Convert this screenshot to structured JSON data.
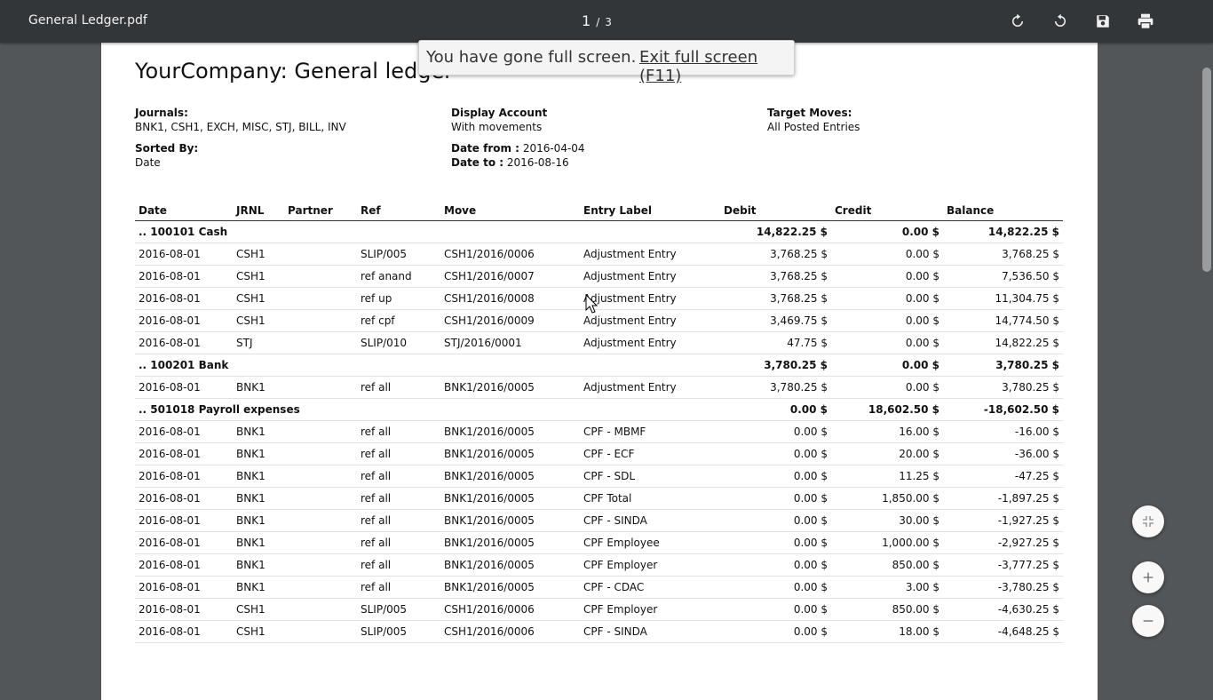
{
  "toolbar": {
    "doc_title": "General Ledger.pdf",
    "page_current": "1",
    "page_separator": "/",
    "page_total": "3",
    "icons": [
      "rotate-clockwise-icon",
      "rotate-counterclockwise-icon",
      "save-icon",
      "print-icon"
    ]
  },
  "fullscreen_toast": {
    "message": "You have gone full screen.",
    "exit_label": "Exit full screen (F11)"
  },
  "report": {
    "title": "YourCompany: General ledger",
    "journals_label": "Journals:",
    "journals_value": "BNK1, CSH1, EXCH, MISC, STJ, BILL, INV",
    "display_account_label": "Display Account",
    "display_account_value": "With movements",
    "target_moves_label": "Target Moves:",
    "target_moves_value": "All Posted Entries",
    "sorted_by_label": "Sorted By:",
    "sorted_by_value": "Date",
    "date_from_label": "Date from :",
    "date_from_value": "2016-04-04",
    "date_to_label": "Date to :",
    "date_to_value": "2016-08-16",
    "columns": [
      "Date",
      "JRNL",
      "Partner",
      "Ref",
      "Move",
      "Entry Label",
      "Debit",
      "Credit",
      "Balance"
    ],
    "rows": [
      {
        "type": "account",
        "label": ".. 100101 Cash",
        "debit": "14,822.25 $",
        "credit": "0.00 $",
        "balance": "14,822.25 $"
      },
      {
        "type": "line",
        "date": "2016-08-01",
        "jrnl": "CSH1",
        "partner": "",
        "ref": "SLIP/005",
        "move": "CSH1/2016/0006",
        "entry": "Adjustment Entry",
        "debit": "3,768.25 $",
        "credit": "0.00 $",
        "balance": "3,768.25 $"
      },
      {
        "type": "line",
        "date": "2016-08-01",
        "jrnl": "CSH1",
        "partner": "",
        "ref": "ref anand",
        "move": "CSH1/2016/0007",
        "entry": "Adjustment Entry",
        "debit": "3,768.25 $",
        "credit": "0.00 $",
        "balance": "7,536.50 $"
      },
      {
        "type": "line",
        "date": "2016-08-01",
        "jrnl": "CSH1",
        "partner": "",
        "ref": "ref up",
        "move": "CSH1/2016/0008",
        "entry": "Adjustment Entry",
        "debit": "3,768.25 $",
        "credit": "0.00 $",
        "balance": "11,304.75 $"
      },
      {
        "type": "line",
        "date": "2016-08-01",
        "jrnl": "CSH1",
        "partner": "",
        "ref": "ref cpf",
        "move": "CSH1/2016/0009",
        "entry": "Adjustment Entry",
        "debit": "3,469.75 $",
        "credit": "0.00 $",
        "balance": "14,774.50 $"
      },
      {
        "type": "line",
        "date": "2016-08-01",
        "jrnl": "STJ",
        "partner": "",
        "ref": "SLIP/010",
        "move": "STJ/2016/0001",
        "entry": "Adjustment Entry",
        "debit": "47.75 $",
        "credit": "0.00 $",
        "balance": "14,822.25 $"
      },
      {
        "type": "account",
        "label": ".. 100201 Bank",
        "debit": "3,780.25 $",
        "credit": "0.00 $",
        "balance": "3,780.25 $"
      },
      {
        "type": "line",
        "date": "2016-08-01",
        "jrnl": "BNK1",
        "partner": "",
        "ref": "ref all",
        "move": "BNK1/2016/0005",
        "entry": "Adjustment Entry",
        "debit": "3,780.25 $",
        "credit": "0.00 $",
        "balance": "3,780.25 $"
      },
      {
        "type": "account",
        "label": ".. 501018 Payroll expenses",
        "debit": "0.00 $",
        "credit": "18,602.50 $",
        "balance": "-18,602.50 $"
      },
      {
        "type": "line",
        "date": "2016-08-01",
        "jrnl": "BNK1",
        "partner": "",
        "ref": "ref all",
        "move": "BNK1/2016/0005",
        "entry": "CPF - MBMF",
        "debit": "0.00 $",
        "credit": "16.00 $",
        "balance": "-16.00 $"
      },
      {
        "type": "line",
        "date": "2016-08-01",
        "jrnl": "BNK1",
        "partner": "",
        "ref": "ref all",
        "move": "BNK1/2016/0005",
        "entry": "CPF - ECF",
        "debit": "0.00 $",
        "credit": "20.00 $",
        "balance": "-36.00 $"
      },
      {
        "type": "line",
        "date": "2016-08-01",
        "jrnl": "BNK1",
        "partner": "",
        "ref": "ref all",
        "move": "BNK1/2016/0005",
        "entry": "CPF - SDL",
        "debit": "0.00 $",
        "credit": "11.25 $",
        "balance": "-47.25 $"
      },
      {
        "type": "line",
        "date": "2016-08-01",
        "jrnl": "BNK1",
        "partner": "",
        "ref": "ref all",
        "move": "BNK1/2016/0005",
        "entry": "CPF Total",
        "debit": "0.00 $",
        "credit": "1,850.00 $",
        "balance": "-1,897.25 $"
      },
      {
        "type": "line",
        "date": "2016-08-01",
        "jrnl": "BNK1",
        "partner": "",
        "ref": "ref all",
        "move": "BNK1/2016/0005",
        "entry": "CPF - SINDA",
        "debit": "0.00 $",
        "credit": "30.00 $",
        "balance": "-1,927.25 $"
      },
      {
        "type": "line",
        "date": "2016-08-01",
        "jrnl": "BNK1",
        "partner": "",
        "ref": "ref all",
        "move": "BNK1/2016/0005",
        "entry": "CPF Employee",
        "debit": "0.00 $",
        "credit": "1,000.00 $",
        "balance": "-2,927.25 $"
      },
      {
        "type": "line",
        "date": "2016-08-01",
        "jrnl": "BNK1",
        "partner": "",
        "ref": "ref all",
        "move": "BNK1/2016/0005",
        "entry": "CPF Employer",
        "debit": "0.00 $",
        "credit": "850.00 $",
        "balance": "-3,777.25 $"
      },
      {
        "type": "line",
        "date": "2016-08-01",
        "jrnl": "BNK1",
        "partner": "",
        "ref": "ref all",
        "move": "BNK1/2016/0005",
        "entry": "CPF - CDAC",
        "debit": "0.00 $",
        "credit": "3.00 $",
        "balance": "-3,780.25 $"
      },
      {
        "type": "line",
        "date": "2016-08-01",
        "jrnl": "CSH1",
        "partner": "",
        "ref": "SLIP/005",
        "move": "CSH1/2016/0006",
        "entry": "CPF Employer",
        "debit": "0.00 $",
        "credit": "850.00 $",
        "balance": "-4,630.25 $"
      },
      {
        "type": "line",
        "date": "2016-08-01",
        "jrnl": "CSH1",
        "partner": "",
        "ref": "SLIP/005",
        "move": "CSH1/2016/0006",
        "entry": "CPF - SINDA",
        "debit": "0.00 $",
        "credit": "18.00 $",
        "balance": "-4,648.25 $"
      }
    ]
  },
  "floating_buttons": [
    "exit-fullscreen-icon",
    "zoom-in-icon",
    "zoom-out-icon"
  ],
  "colors": {
    "toolbar_bg": "#323639",
    "viewer_bg": "#525659",
    "page_bg": "#ffffff"
  }
}
